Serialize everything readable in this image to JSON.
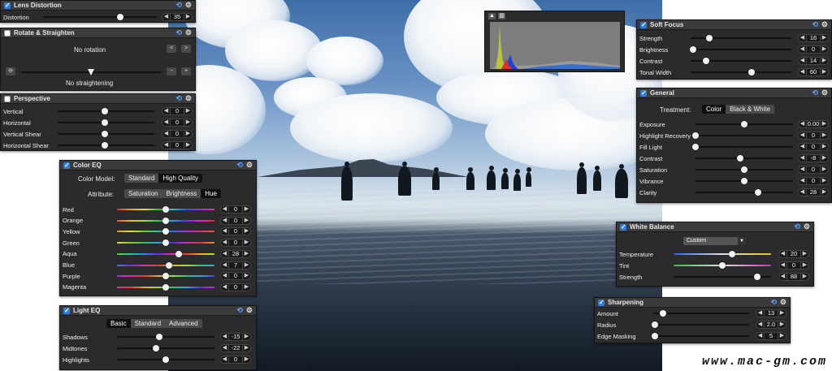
{
  "panels": {
    "lens_distortion": {
      "title": "Lens Distortion",
      "checked": true,
      "rows": [
        {
          "label": "Distortion",
          "value": "35"
        }
      ]
    },
    "rotate": {
      "title": "Rotate & Straighten",
      "checked": false,
      "rotation_text": "No rotation",
      "straighten_text": "No straightening"
    },
    "perspective": {
      "title": "Perspective",
      "checked": false,
      "rows": [
        {
          "label": "Vertical",
          "value": "0"
        },
        {
          "label": "Horizontal",
          "value": "0"
        },
        {
          "label": "Vertical Shear",
          "value": "0"
        },
        {
          "label": "Horizontal Shear",
          "value": "0"
        }
      ]
    },
    "color_eq": {
      "title": "Color EQ",
      "checked": true,
      "model_label": "Color Model:",
      "model_options": [
        "Standard",
        "High Quality"
      ],
      "model_selected": "High Quality",
      "attr_label": "Attribute:",
      "attr_options": [
        "Saturation",
        "Brightness",
        "Hue"
      ],
      "attr_selected": "Hue",
      "rows": [
        {
          "label": "Red",
          "value": "0"
        },
        {
          "label": "Orange",
          "value": "0"
        },
        {
          "label": "Yellow",
          "value": "0"
        },
        {
          "label": "Green",
          "value": "0"
        },
        {
          "label": "Aqua",
          "value": "28"
        },
        {
          "label": "Blue",
          "value": "7"
        },
        {
          "label": "Purple",
          "value": "0"
        },
        {
          "label": "Magenta",
          "value": "0"
        }
      ]
    },
    "light_eq": {
      "title": "Light EQ",
      "checked": true,
      "tabs": [
        "Basic",
        "Standard",
        "Advanced"
      ],
      "tab_selected": "Basic",
      "rows": [
        {
          "label": "Shadows",
          "value": "-15"
        },
        {
          "label": "Midtones",
          "value": "-22"
        },
        {
          "label": "Highlights",
          "value": "0"
        }
      ]
    },
    "soft_focus": {
      "title": "Soft Focus",
      "checked": true,
      "rows": [
        {
          "label": "Strength",
          "value": "16"
        },
        {
          "label": "Brightness",
          "value": "0"
        },
        {
          "label": "Contrast",
          "value": "14"
        },
        {
          "label": "Tonal Width",
          "value": "60"
        }
      ]
    },
    "general": {
      "title": "General",
      "checked": true,
      "treatment_label": "Treatment:",
      "treatment_options": [
        "Color",
        "Black & White"
      ],
      "treatment_selected": "Color",
      "rows": [
        {
          "label": "Exposure",
          "value": "0.00"
        },
        {
          "label": "Highlight Recovery",
          "value": "0"
        },
        {
          "label": "Fill Light",
          "value": "0"
        },
        {
          "label": "Contrast",
          "value": "-8"
        },
        {
          "label": "Saturation",
          "value": "0"
        },
        {
          "label": "Vibrance",
          "value": "0"
        },
        {
          "label": "Clarity",
          "value": "28"
        }
      ]
    },
    "white_balance": {
      "title": "White Balance",
      "checked": true,
      "preset": "Custom",
      "rows": [
        {
          "label": "Temperature",
          "value": "20"
        },
        {
          "label": "Tint",
          "value": "0"
        },
        {
          "label": "Strength",
          "value": "88"
        }
      ]
    },
    "sharpening": {
      "title": "Sharpening",
      "checked": true,
      "rows": [
        {
          "label": "Amount",
          "value": "13"
        },
        {
          "label": "Radius",
          "value": "2.0"
        },
        {
          "label": "Edge Masking",
          "value": "5"
        }
      ]
    }
  },
  "watermark": "www.mac-gm.com"
}
